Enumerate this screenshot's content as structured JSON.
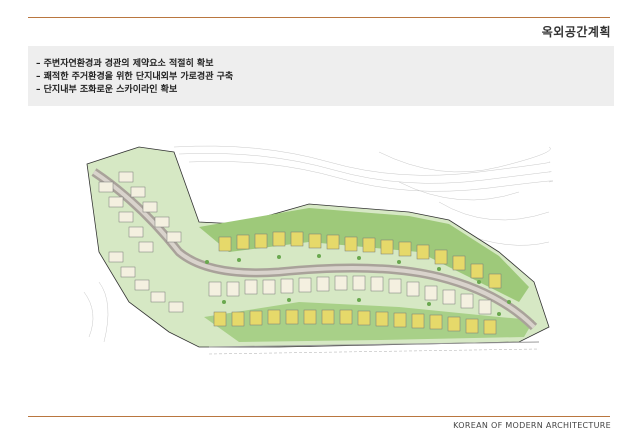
{
  "header": {
    "title": "옥외공간계획"
  },
  "bullets": [
    "– 주변자연환경과 경관의 제약요소 적절히 확보",
    "– 쾌적한 주거환경을 위한 단지내외부 가로경관 구축",
    "– 단지내부 조화로운 스카이라인 확보"
  ],
  "footer": {
    "text": "KOREAN OF MODERN ARCHITECTURE"
  },
  "colors": {
    "accent_rule": "#b9763f",
    "bullet_box": "#eeeeee",
    "landscape_green": "#9ec97a",
    "road_gray": "#a9a29a",
    "roof_yellow": "#e6d96a"
  }
}
